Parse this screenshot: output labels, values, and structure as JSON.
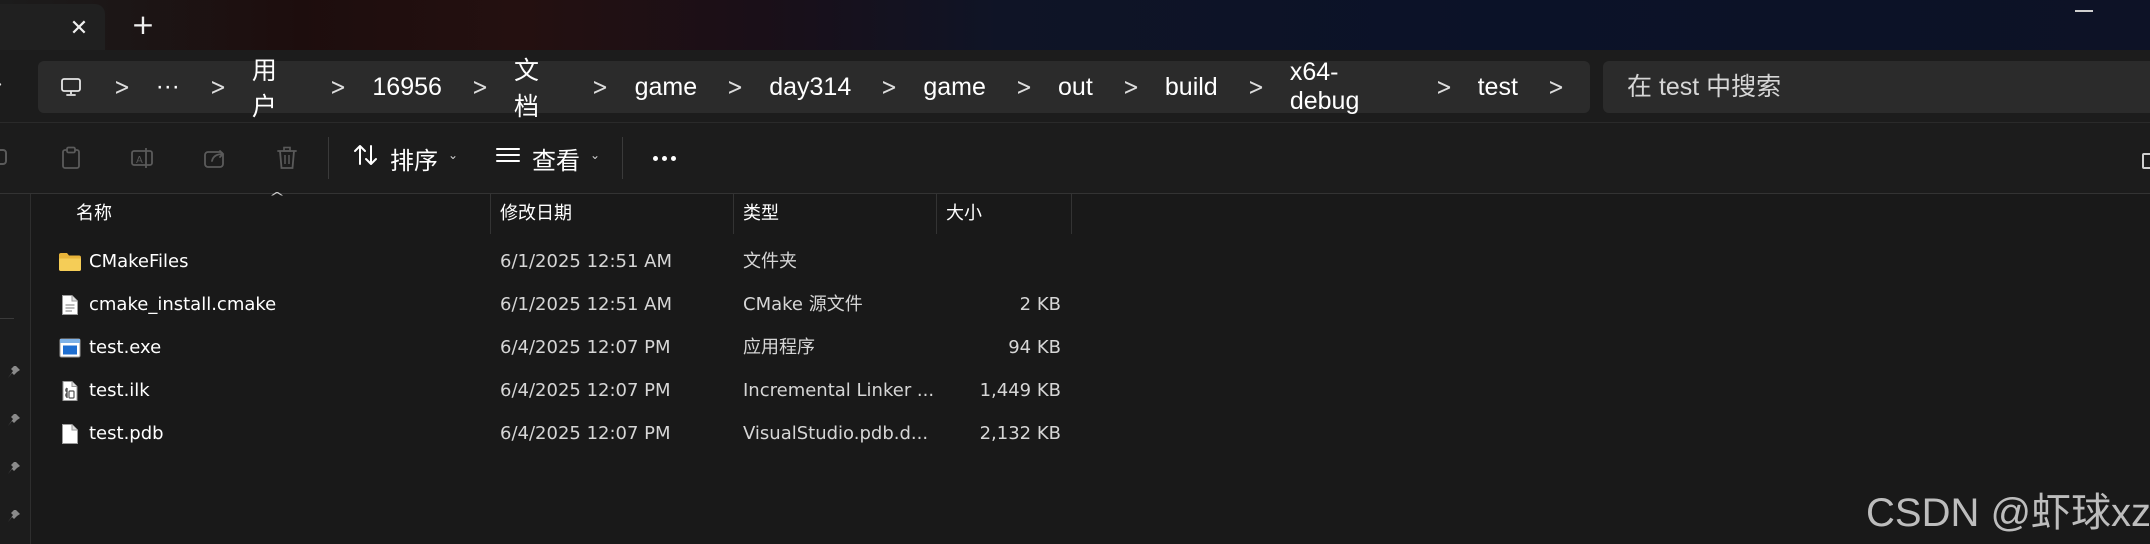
{
  "tab": {
    "close_icon": "close-icon",
    "new_tab_symbol": "+"
  },
  "address": {
    "breadcrumbs": [
      "用户",
      "16956",
      "文档",
      "game",
      "day314",
      "game",
      "out",
      "build",
      "x64-debug",
      "test"
    ],
    "overflow_label": "···"
  },
  "search": {
    "placeholder": "在 test 中搜索"
  },
  "toolbar": {
    "sort_label": "排序",
    "view_label": "查看",
    "more_label": "more-options"
  },
  "columns": {
    "name": "名称",
    "date": "修改日期",
    "type": "类型",
    "size": "大小"
  },
  "files": [
    {
      "icon": "folder-icon",
      "name": "CMakeFiles",
      "date": "6/1/2025 12:51 AM",
      "type": "文件夹",
      "size": ""
    },
    {
      "icon": "document-icon",
      "name": "cmake_install.cmake",
      "date": "6/1/2025 12:51 AM",
      "type": "CMake 源文件",
      "size": "2 KB"
    },
    {
      "icon": "exe-icon",
      "name": "test.exe",
      "date": "6/4/2025 12:07 PM",
      "type": "应用程序",
      "size": "94 KB"
    },
    {
      "icon": "ilk-icon",
      "name": "test.ilk",
      "date": "6/4/2025 12:07 PM",
      "type": "Incremental Linker ...",
      "size": "1,449 KB"
    },
    {
      "icon": "file-icon",
      "name": "test.pdb",
      "date": "6/4/2025 12:07 PM",
      "type": "VisualStudio.pdb.d...",
      "size": "2,132 KB"
    }
  ],
  "watermark": "CSDN @虾球xz",
  "colors": {
    "background": "#191919",
    "folder": "#f2c744",
    "accent": "#4a9be6"
  }
}
